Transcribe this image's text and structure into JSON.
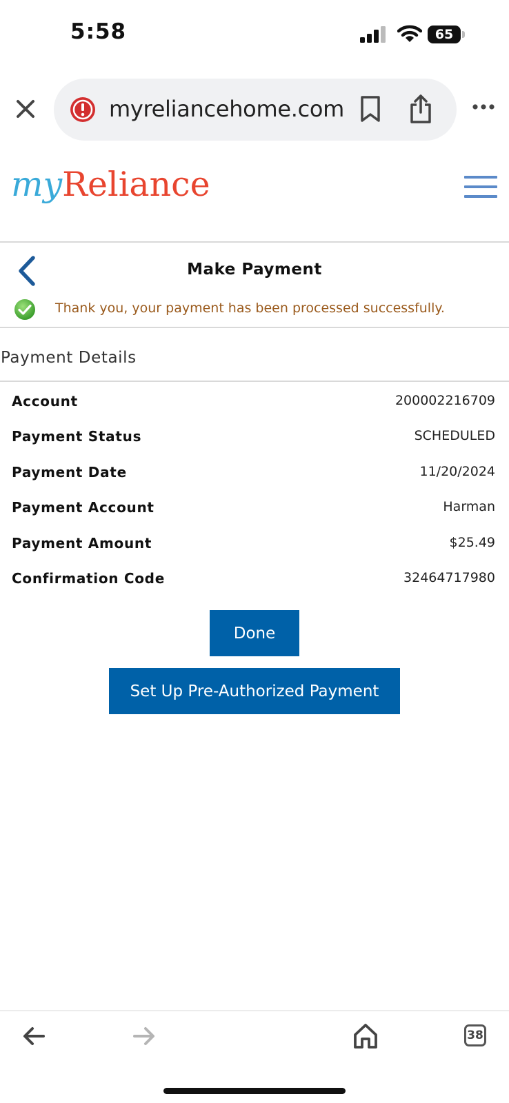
{
  "status_bar": {
    "time": "5:58",
    "battery": "65",
    "icons": [
      "cellular-signal-icon",
      "wifi-icon",
      "battery-icon"
    ]
  },
  "browser": {
    "url": "myreliancehome.com",
    "security_indicator": "warning",
    "icons": [
      "close-icon",
      "alert-icon",
      "bookmark-icon",
      "share-icon",
      "more-icon"
    ]
  },
  "site_header": {
    "logo_prefix": "my",
    "logo_name": "Reliance",
    "menu_icon": "hamburger-menu-icon",
    "colors": {
      "logo_my": "#3aaad9",
      "logo_reliance": "#e8452f",
      "menu": "#5b8ac9"
    }
  },
  "page": {
    "title": "Make Payment",
    "success_message": "Thank you, your payment has been processed successfully.",
    "section_title": "Payment Details"
  },
  "details": [
    {
      "label": "Account",
      "value": "200002216709"
    },
    {
      "label": "Payment Status",
      "value": "SCHEDULED"
    },
    {
      "label": "Payment Date",
      "value": "11/20/2024"
    },
    {
      "label": "Payment Account",
      "value": "Harman"
    },
    {
      "label": "Payment Amount",
      "value": "$25.49"
    },
    {
      "label": "Confirmation Code",
      "value": "32464717980"
    }
  ],
  "buttons": {
    "done": "Done",
    "preauth": "Set Up Pre-Authorized Payment",
    "color": "#0061a8"
  },
  "bottom_toolbar": {
    "tab_count": "38",
    "icons": [
      "back-arrow-icon",
      "forward-arrow-icon",
      "home-icon",
      "tabs-icon"
    ]
  }
}
